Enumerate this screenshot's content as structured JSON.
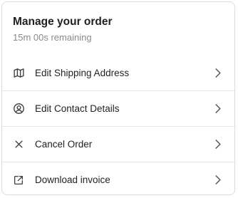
{
  "header": {
    "title": "Manage your order",
    "subtitle": "15m 00s remaining"
  },
  "menu": {
    "items": [
      {
        "label": "Edit Shipping Address",
        "icon": "map-icon"
      },
      {
        "label": "Edit Contact Details",
        "icon": "user-circle-icon"
      },
      {
        "label": "Cancel Order",
        "icon": "close-icon"
      },
      {
        "label": "Download invoice",
        "icon": "external-link-icon"
      }
    ]
  },
  "colors": {
    "border": "#dcdcdc",
    "divider": "#e6e6e6",
    "subtitle": "#8a8a8a"
  }
}
